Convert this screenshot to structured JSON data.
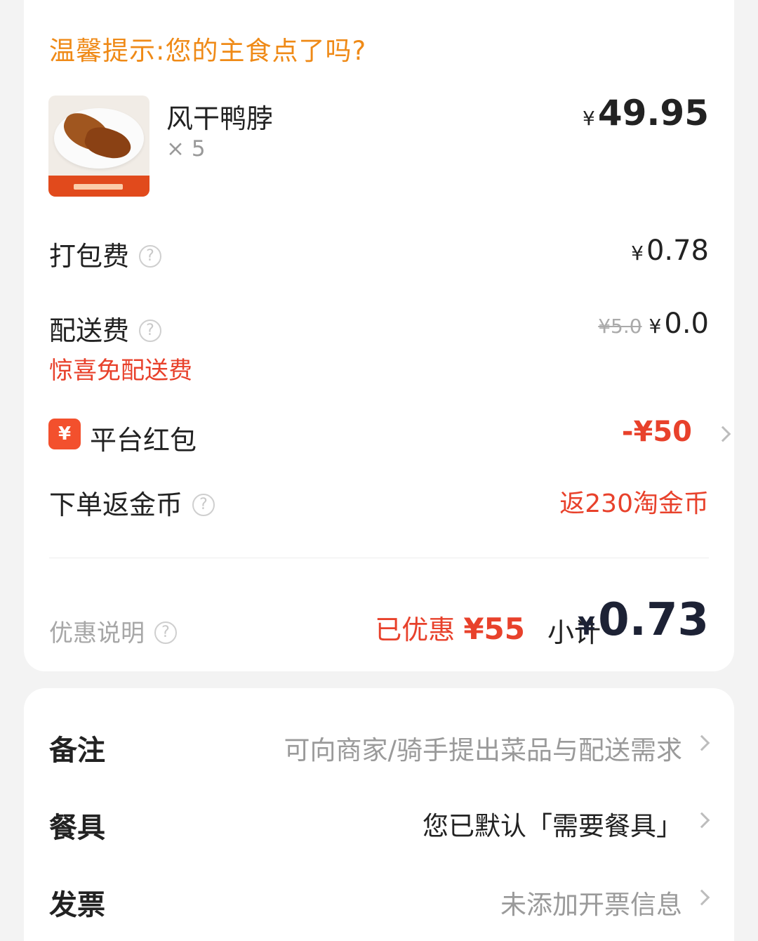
{
  "order": {
    "tip": "温馨提示:您的主食点了吗?",
    "item": {
      "name": "风干鸭脖",
      "quantity": "× 5",
      "currency": "¥",
      "price": "49.95",
      "image_icon": "food-image"
    },
    "packaging": {
      "label": "打包费",
      "currency": "¥",
      "value": "0.78"
    },
    "delivery": {
      "label": "配送费",
      "original": "¥5.0",
      "currency": "¥",
      "value": "0.0",
      "promo": "惊喜免配送费"
    },
    "red_packet": {
      "icon_text": "¥",
      "label": "平台红包",
      "value": "-¥50"
    },
    "coins": {
      "label": "下单返金币",
      "value": "返230淘金币"
    },
    "summary": {
      "promo_label": "优惠说明",
      "saved_prefix": "已优惠",
      "saved_value": "¥55",
      "subtotal_label": "小计",
      "currency": "¥",
      "subtotal_value": "0.73"
    }
  },
  "extras": {
    "remark": {
      "label": "备注",
      "value": "可向商家/骑手提出菜品与配送需求"
    },
    "cutlery": {
      "label": "餐具",
      "value": "您已默认「需要餐具」"
    },
    "invoice": {
      "label": "发票",
      "value": "未添加开票信息"
    }
  },
  "colors": {
    "accent_orange": "#ef8a17",
    "accent_red": "#e8412b",
    "text_dark": "#222222",
    "text_muted": "#a7a7a7"
  }
}
